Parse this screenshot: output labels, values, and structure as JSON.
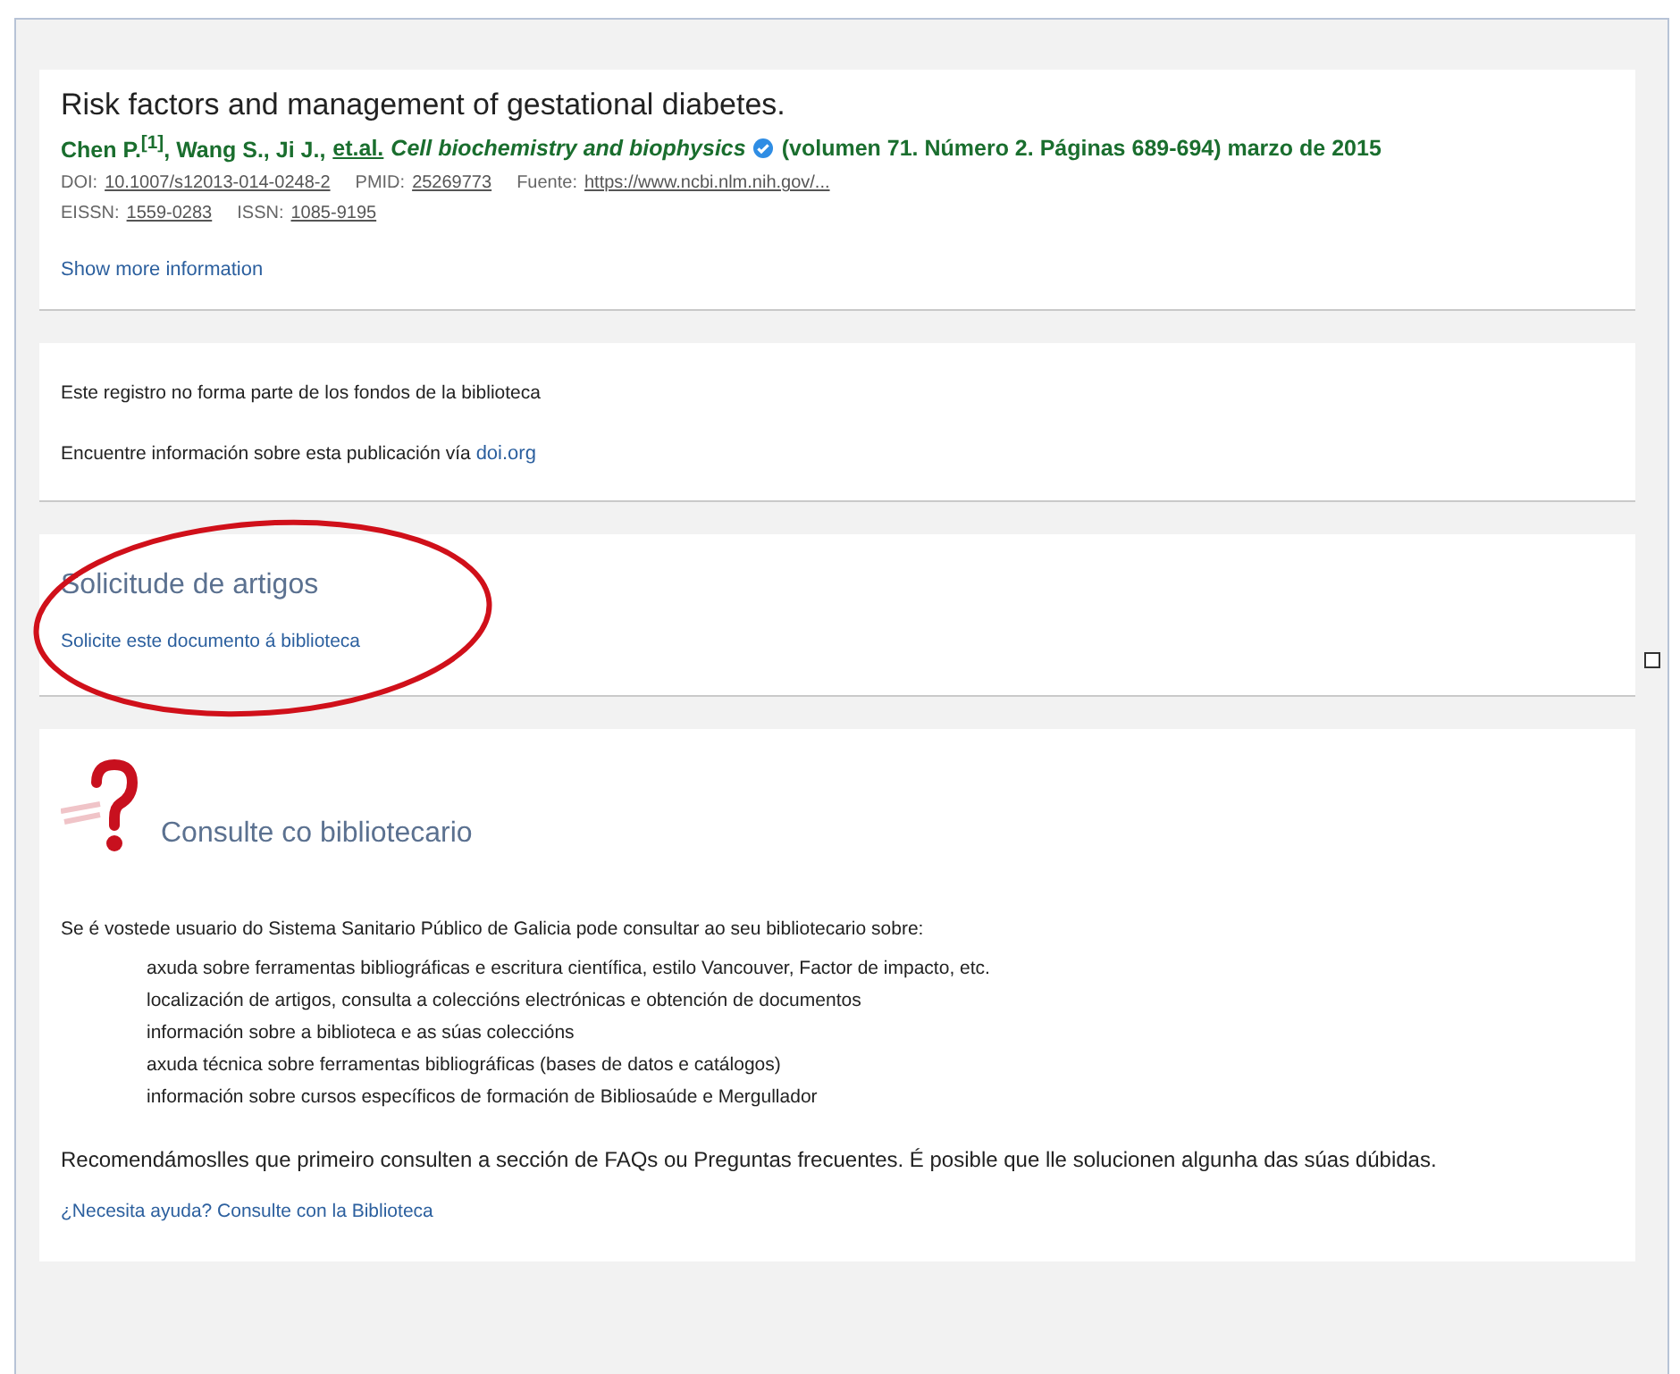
{
  "record": {
    "title": "Risk factors and management of gestational diabetes.",
    "authors": "Chen P.$^{[1]}$, Wang S., Ji J.,",
    "et_al": "et.al.",
    "journal": "Cell biochemistry and biophysics",
    "journal_verified": true,
    "issue": "(volumen 71. Número 2. Páginas 689-694) marzo de 2015",
    "identifier_rows": [
      [
        {
          "label": "DOI:",
          "value": "10.1007/s12013-014-0248-2"
        },
        {
          "label": "PMID:",
          "value": "25269773"
        },
        {
          "label": "Fuente:",
          "value": "https://www.ncbi.nlm.nih.gov/..."
        }
      ],
      [
        {
          "label": "EISSN:",
          "value": "1559-0283"
        },
        {
          "label": "ISSN:",
          "value": "1085-9195"
        }
      ]
    ],
    "show_more": "Show more information"
  },
  "holdings": {
    "note": "Este registro no forma parte de los fondos de la biblioteca",
    "find_text": "Encuentre información sobre esta publicación vía",
    "find_link": "doi.org"
  },
  "requests": {
    "heading": "Solicitude de artigos",
    "link": "Solicite este documento á biblioteca",
    "annotated": true
  },
  "librarian": {
    "heading": "Consulte co bibliotecario",
    "intro": "Se é vostede usuario do Sistema Sanitario Público de Galicia pode consultar ao seu bibliotecario sobre:",
    "topics": [
      "axuda sobre ferramentas bibliográficas e escritura científica, estilo Vancouver, Factor de impacto, etc.",
      "localización de artigos, consulta a coleccións electrónicas e obtención de documentos",
      "información sobre a biblioteca e as súas coleccións",
      "axuda técnica sobre ferramentas bibliográficas (bases de datos e catálogos)",
      "información sobre cursos específicos de formación de Bibliosaúde e Mergullador"
    ],
    "recommendation": "Recomendámoslles que primeiro consulten a sección de FAQs ou Preguntas frecuentes. É posible que lle solucionen algunha das súas dúbidas.",
    "help_link": "¿Necesita ayuda? Consulte con la Biblioteca"
  }
}
